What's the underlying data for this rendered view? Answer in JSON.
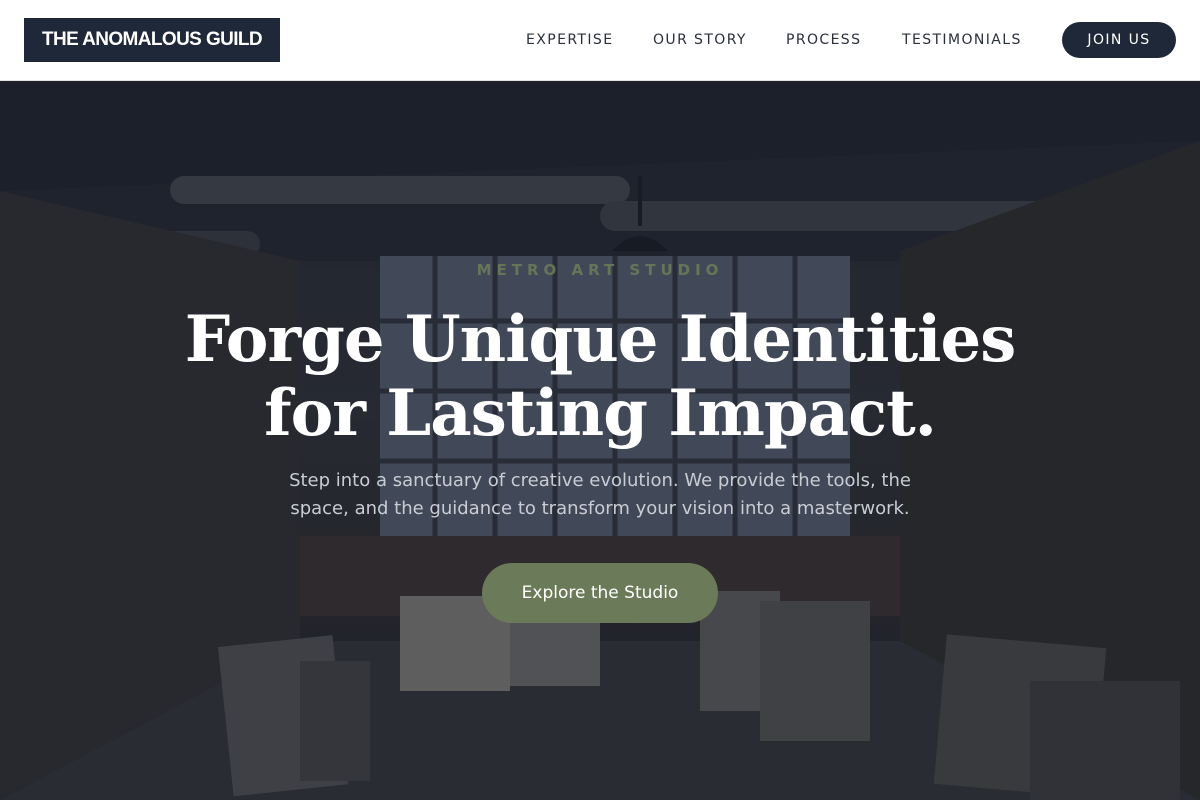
{
  "brand": {
    "name": "THE ANOMALOUS GUILD"
  },
  "nav": {
    "links": [
      {
        "label": "EXPERTISE"
      },
      {
        "label": "OUR STORY"
      },
      {
        "label": "PROCESS"
      },
      {
        "label": "TESTIMONIALS"
      }
    ],
    "cta_label": "JOIN US"
  },
  "hero": {
    "eyebrow": "METRO ART STUDIO",
    "headline_line1": "Forge Unique Identities",
    "headline_line2": "for Lasting Impact.",
    "subtitle": "Step into a sanctuary of creative evolution. We provide the tools, the space, and the guidance to transform your vision into a masterwork.",
    "cta_label": "Explore the Studio",
    "background_image": "art-studio-workshop-photo"
  },
  "colors": {
    "brand_dark": "#1f2838",
    "accent_green": "#6b7a58",
    "hero_overlay": "#141a28"
  }
}
